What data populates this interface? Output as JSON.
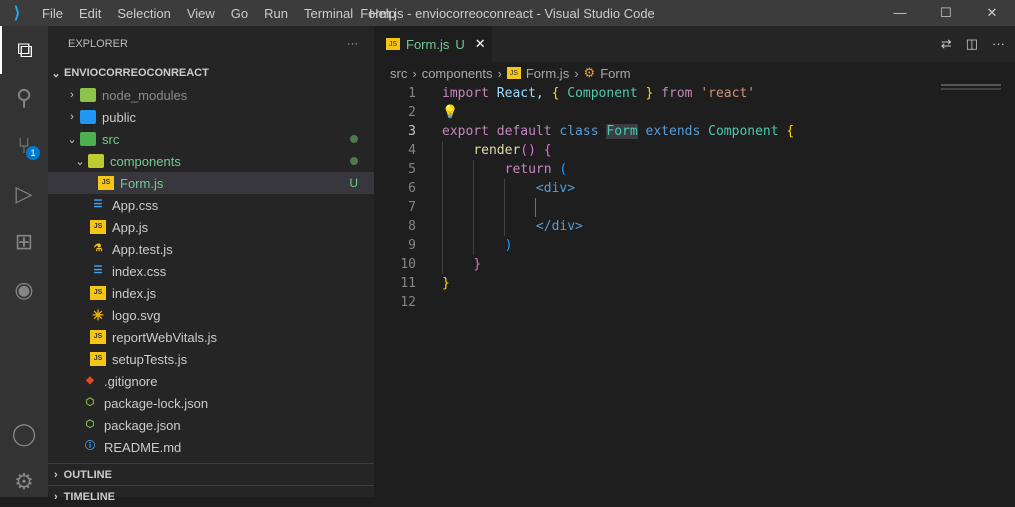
{
  "titlebar": {
    "menu": [
      "File",
      "Edit",
      "Selection",
      "View",
      "Go",
      "Run",
      "Terminal",
      "Help"
    ],
    "title": "Form.js - enviocorreoconreact - Visual Studio Code"
  },
  "activity": {
    "scm_badge": "1"
  },
  "sidebar": {
    "title": "EXPLORER",
    "more": "···",
    "project": "ENVIOCORREOCONREACT",
    "items": [
      {
        "label": "node_modules",
        "status": ""
      },
      {
        "label": "public",
        "status": ""
      },
      {
        "label": "src",
        "status": "●"
      },
      {
        "label": "components",
        "status": "●"
      },
      {
        "label": "Form.js",
        "status": "U"
      },
      {
        "label": "App.css"
      },
      {
        "label": "App.js"
      },
      {
        "label": "App.test.js"
      },
      {
        "label": "index.css"
      },
      {
        "label": "index.js"
      },
      {
        "label": "logo.svg"
      },
      {
        "label": "reportWebVitals.js"
      },
      {
        "label": "setupTests.js"
      },
      {
        "label": ".gitignore"
      },
      {
        "label": "package-lock.json"
      },
      {
        "label": "package.json"
      },
      {
        "label": "README.md"
      }
    ],
    "outline": "OUTLINE",
    "timeline": "TIMELINE"
  },
  "editor": {
    "tab": {
      "label": "Form.js",
      "status": "U"
    },
    "breadcrumbs": [
      "src",
      "components",
      "Form.js",
      "Form"
    ],
    "line_numbers": [
      "1",
      "2",
      "3",
      "4",
      "5",
      "6",
      "7",
      "8",
      "9",
      "10",
      "11",
      "12"
    ]
  },
  "code": {
    "l1": [
      "import",
      " React, ",
      "{",
      " Component ",
      "}",
      " from ",
      "'react'"
    ],
    "l3": [
      "export default ",
      "class ",
      "Form",
      " extends ",
      "Component",
      " {"
    ],
    "l4": [
      "render",
      "()",
      " {"
    ],
    "l5": [
      "return",
      " ("
    ],
    "l6": "<div>",
    "l8": "</div>",
    "l9": ")",
    "l10": "}",
    "l11": "}"
  }
}
